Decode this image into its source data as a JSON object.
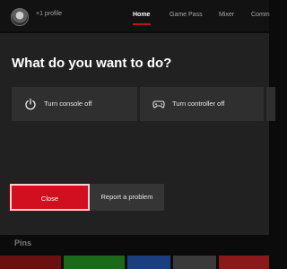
{
  "background": {
    "profile_label": "+1 profile",
    "nav": [
      {
        "label": "Home",
        "active": true
      },
      {
        "label": "Game Pass",
        "active": false
      },
      {
        "label": "Mixer",
        "active": false
      },
      {
        "label": "Comm",
        "active": false
      }
    ],
    "pins_label": "Pins",
    "tile_colors": [
      "#6a1010",
      "#1a6a1a",
      "#1a3e80",
      "#3a3a3a",
      "#8a1a1a"
    ]
  },
  "dialog": {
    "title": "What do you want to do?",
    "options": [
      {
        "label": "Turn console off",
        "icon": "power-icon"
      },
      {
        "label": "Turn controller off",
        "icon": "controller-icon"
      }
    ],
    "buttons": {
      "close_label": "Close",
      "report_label": "Report a problem"
    }
  },
  "colors": {
    "accent": "#d20f1e",
    "dialog_bg": "#212121",
    "option_bg": "#2f2f2f"
  }
}
